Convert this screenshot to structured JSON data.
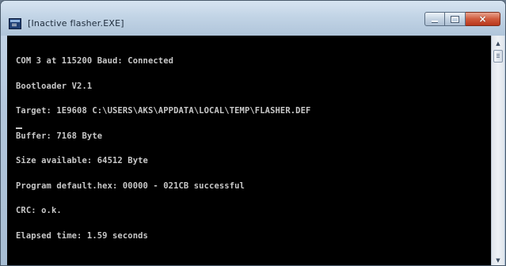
{
  "window": {
    "title": "[Inactive flasher.EXE]"
  },
  "caption_buttons": {
    "minimize_icon": "minimize-icon",
    "maximize_icon": "maximize-icon",
    "close_icon": "close-icon",
    "close_glyph": "×"
  },
  "console": {
    "lines": [
      "COM 3 at 115200 Baud: Connected",
      "Bootloader V2.1",
      "Target: 1E9608 C:\\USERS\\AKS\\APPDATA\\LOCAL\\TEMP\\FLASHER.DEF",
      "Buffer: 7168 Byte",
      "Size available: 64512 Byte",
      "Program default.hex: 00000 - 021CB successful",
      "CRC: o.k.",
      "Elapsed time: 1.59 seconds"
    ],
    "text_color": "#c8c8c8",
    "background": "#000000"
  },
  "scrollbar": {
    "up_glyph": "▲",
    "down_glyph": "▼"
  }
}
